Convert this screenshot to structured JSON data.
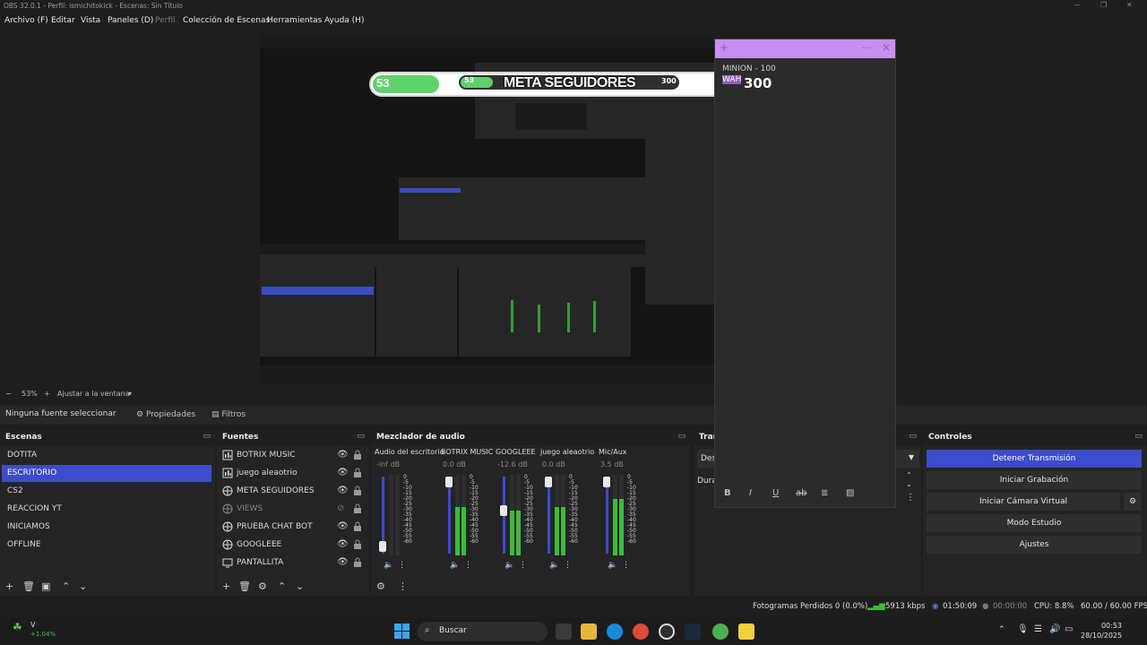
{
  "window": {
    "title": "OBS 32.0.1 - Perfil: ismichitokick - Escenas: Sin Título",
    "minimize": "—",
    "maximize": "❐",
    "close": "✕"
  },
  "menu": {
    "items": [
      "Archivo (F)",
      "Editar",
      "Vista",
      "Paneles (D)",
      "Perfil",
      "Colección de Escenas",
      "Herramientas",
      "Ayuda (H)"
    ]
  },
  "preview": {
    "goal_widget": {
      "current": "53",
      "inner_current": "53",
      "title": "META SEGUIDORES",
      "inner_target": "300",
      "target": "300"
    },
    "overlay_text_1": "MINION - 100",
    "overlay_text_2": "WAH",
    "nested_tabs": [
      "Ninguna fuente seleccionada",
      "Propiedades",
      "Filtros"
    ]
  },
  "zoom_row": {
    "minus": "−",
    "zoom": "53%",
    "plus": "+",
    "fit": "Ajustar a la ventana"
  },
  "source_toolbar": {
    "no_source": "Ninguna fuente seleccionar",
    "properties": "Propiedades",
    "filters": "Filtros"
  },
  "scenes": {
    "header": "Escenas",
    "items": [
      "DOTITA",
      "ESCRITORIO",
      "CS2",
      "REACCION YT",
      "INICIAMOS",
      "OFFLINE"
    ],
    "selected": "ESCRITORIO"
  },
  "sources": {
    "header": "Fuentes",
    "items": [
      {
        "name": "BOTRIX MUSIC",
        "icon": "audio-icon",
        "visible": true
      },
      {
        "name": "juego aleaotrio",
        "icon": "audio-icon",
        "visible": true
      },
      {
        "name": "META SEGUIDORES",
        "icon": "browser-icon",
        "visible": true
      },
      {
        "name": "VIEWS",
        "icon": "browser-icon",
        "visible": false
      },
      {
        "name": "PRUEBA CHAT BOT",
        "icon": "browser-icon",
        "visible": true
      },
      {
        "name": "GOOGLEEE",
        "icon": "browser-icon",
        "visible": true
      },
      {
        "name": "PANTALLITA",
        "icon": "display-icon",
        "visible": true
      }
    ]
  },
  "mixer": {
    "header": "Mezclador de audio",
    "channels": [
      {
        "name": "Audio del escritorio",
        "db": "-inf dB",
        "volume": 0.1,
        "level": 0
      },
      {
        "name": "BOTRIX MUSIC",
        "db": "0.0 dB",
        "volume": 1.0,
        "level": 0.6
      },
      {
        "name": "GOOGLEEE",
        "db": "-12.6 dB",
        "volume": 0.6,
        "level": 0.55
      },
      {
        "name": "juego aleaotrio",
        "db": "0.0 dB",
        "volume": 1.0,
        "level": 0.6
      },
      {
        "name": "Mic/Aux",
        "db": "3.5 dB",
        "volume": 1.0,
        "level": 0.7
      }
    ],
    "scale": [
      "0",
      "-5",
      "-10",
      "-15",
      "-20",
      "-25",
      "-30",
      "-35",
      "-40",
      "-45",
      "-50",
      "-55",
      "-60"
    ]
  },
  "transitions": {
    "header": "Trar",
    "select_value": "Des",
    "duration_label": "Dura"
  },
  "controls": {
    "header": "Controles",
    "buttons": [
      "Detener Transmisión",
      "Iniciar Grabación",
      "Iniciar Cámara Virtual",
      "Modo Estudio",
      "Ajustes"
    ]
  },
  "status": {
    "dropped": "Fotogramas Perdidos 0 (0.0%)",
    "bitrate": "5913 kbps",
    "stream_time": "01:50:09",
    "rec_time": "00:00:00",
    "cpu": "CPU: 8.8%",
    "fps": "60.00 / 60.00 FPS"
  },
  "taskbar": {
    "search_placeholder": "Buscar",
    "weather_temp": "V",
    "weather_change": "+1.04%",
    "time": "00:53",
    "date": "28/10/2025"
  },
  "colors": {
    "accent": "#3c4ccc",
    "notes_header": "#c78ff0",
    "meter_green": "#3cbc3c",
    "goal_green": "#5ed16a"
  }
}
